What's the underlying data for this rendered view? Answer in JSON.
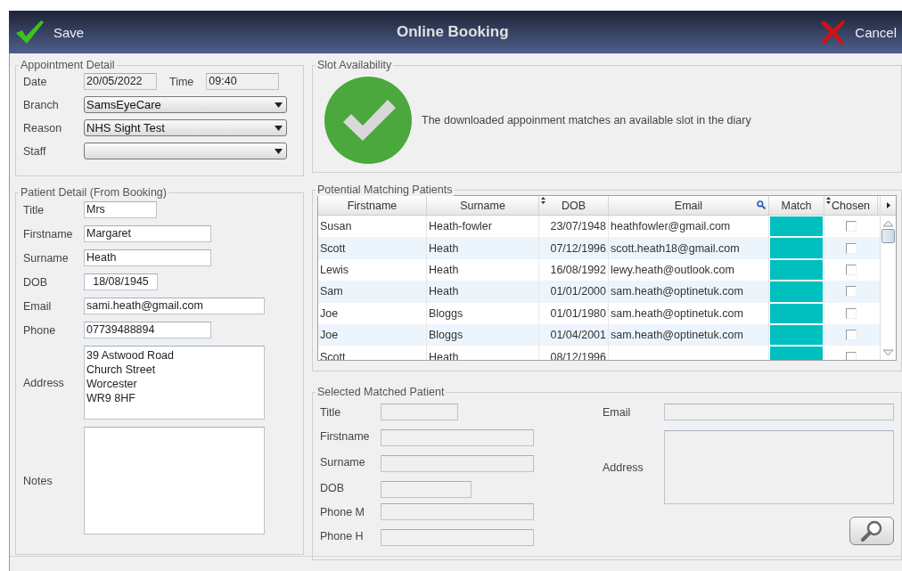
{
  "header": {
    "save": "Save",
    "title": "Online Booking",
    "cancel": "Cancel"
  },
  "appointment": {
    "legend": "Appointment Detail",
    "date_label": "Date",
    "date": "20/05/2022",
    "time_label": "Time",
    "time": "09:40",
    "dropdowns": [
      {
        "label": "Branch",
        "value": "SamsEyeCare"
      },
      {
        "label": "Reason",
        "value": "NHS Sight Test"
      },
      {
        "label": "Staff"
      }
    ]
  },
  "patient": {
    "legend": "Patient Detail (From Booking)",
    "fields": [
      {
        "label": "Title",
        "value": "Mrs",
        "kind": "short"
      },
      {
        "label": "Firstname",
        "value": "Margaret",
        "kind": "medium"
      },
      {
        "label": "Surname",
        "value": "Heath",
        "kind": "medium"
      },
      {
        "label": "DOB",
        "value": "18/08/1945",
        "kind": "date"
      },
      {
        "label": "Email",
        "value": "sami.heath@gmail.com",
        "kind": "long"
      },
      {
        "label": "Phone",
        "value": "07739488894",
        "kind": "medium"
      },
      {
        "label": "Address",
        "value": "39 Astwood Road\nChurch Street\nWorcester\nWR9 8HF",
        "kind": "area"
      },
      {
        "label": "Notes",
        "kind": "notes"
      }
    ]
  },
  "slot": {
    "legend": "Slot Availability",
    "available": true,
    "message": "The downloaded appoinment matches an available slot in the diary"
  },
  "matches": {
    "legend": "Potential Matching Patients",
    "columns": [
      "Firstname",
      "Surname",
      "DOB",
      "Email",
      "Match",
      "Chosen"
    ],
    "rows": [
      {
        "cells": [
          "Susan",
          "Heath-fowler",
          "23/07/1948",
          "heathfowler@gmail.com"
        ],
        "color": "#00bfbf",
        "chosen": false
      },
      {
        "cells": [
          "Scott",
          "Heath",
          "07/12/1996",
          "scott.heath18@gmail.com"
        ],
        "color": "#00bfbf",
        "chosen": false
      },
      {
        "cells": [
          "Lewis",
          "Heath",
          "16/08/1992",
          "lewy.heath@outlook.com"
        ],
        "color": "#00bfbf",
        "chosen": false
      },
      {
        "cells": [
          "Sam",
          "Heath",
          "01/01/2000",
          "sam.heath@optinetuk.com"
        ],
        "color": "#00bfbf",
        "chosen": false
      },
      {
        "cells": [
          "Joe",
          "Bloggs",
          "01/01/1980",
          "sam.heath@optinetuk.com"
        ],
        "color": "#00bfbf",
        "chosen": false
      },
      {
        "cells": [
          "Joe",
          "Bloggs",
          "01/04/2001",
          "sam.heath@optinetuk.com"
        ],
        "color": "#00bfbf",
        "chosen": false
      },
      {
        "cells": [
          "Scott",
          "Heath",
          "08/12/1996"
        ],
        "color": "#00bfbf",
        "chosen": false
      }
    ]
  },
  "selected": {
    "legend": "Selected Matched Patient",
    "left_fields": [
      {
        "label": "Title",
        "kind": "short"
      },
      {
        "label": "Firstname",
        "kind": "medium"
      },
      {
        "label": "Surname",
        "kind": "medium"
      },
      {
        "label": "DOB",
        "kind": "date"
      },
      {
        "label": "Phone M",
        "kind": "medium"
      },
      {
        "label": "Phone H",
        "kind": "medium"
      }
    ],
    "right_fields": [
      {
        "label": "Email",
        "kind": "long"
      },
      {
        "label": "Address",
        "kind": "area"
      }
    ]
  }
}
